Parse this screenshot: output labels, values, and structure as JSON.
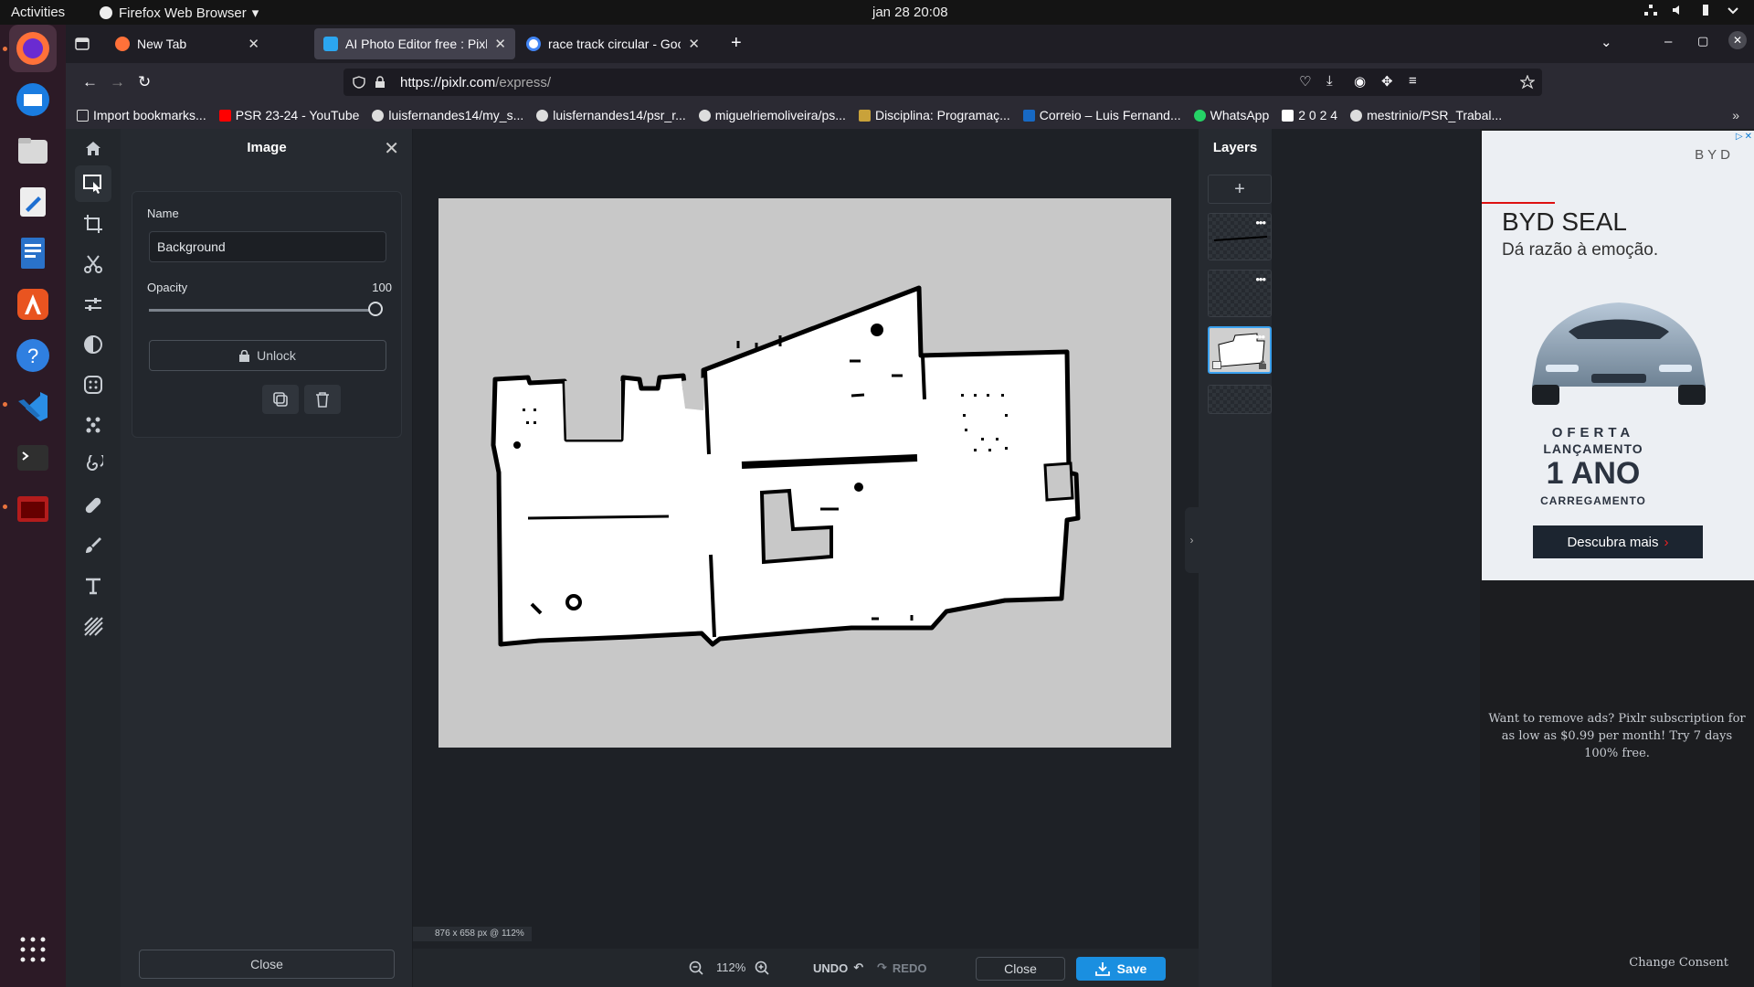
{
  "topbar": {
    "activities": "Activities",
    "app_name": "Firefox Web Browser",
    "clock": "jan 28  20:08"
  },
  "browser": {
    "tabs": [
      {
        "title": "New Tab"
      },
      {
        "title": "AI Photo Editor free : Pixlr"
      },
      {
        "title": "race track circular - Google"
      }
    ],
    "url_host": "https://pixlr.com",
    "url_path": "/express/",
    "bookmarks": [
      "Import bookmarks...",
      "PSR 23-24 - YouTube",
      "luisfernandes14/my_s...",
      "luisfernandes14/psr_r...",
      "miguelriemoliveira/ps...",
      "Disciplina: Programaç...",
      "Correio – Luis Fernand...",
      "WhatsApp",
      "2 0 2 4",
      "mestrinio/PSR_Trabal..."
    ]
  },
  "panel": {
    "title": "Image",
    "name_label": "Name",
    "name_value": "Background",
    "opacity_label": "Opacity",
    "opacity_value": "100",
    "opacity_fraction": 1.0,
    "unlock_label": "Unlock",
    "close_label": "Close"
  },
  "workspace": {
    "dims": "876 x 658 px @ 112%"
  },
  "bottombar": {
    "zoom": "112%",
    "undo": "UNDO",
    "redo": "REDO",
    "close": "Close",
    "save": "Save"
  },
  "layers": {
    "title": "Layers",
    "selected_index": 2
  },
  "ad": {
    "brand": "BYD",
    "headline": "BYD SEAL",
    "tagline": "Dá razão à emoção.",
    "offer_line1": "OFERTA",
    "offer_line2": "LANÇAMENTO",
    "offer_big": "1 ANO",
    "offer_line3": "CARREGAMENTO",
    "cta": "Descubra mais",
    "remove_ads": "Want to remove ads? Pixlr subscription for as low as $0.99 per month! Try 7 days 100% free.",
    "consent": "Change Consent"
  },
  "colors": {
    "accent": "#1a8fe0",
    "canvas_bg": "#c8c8c8"
  }
}
